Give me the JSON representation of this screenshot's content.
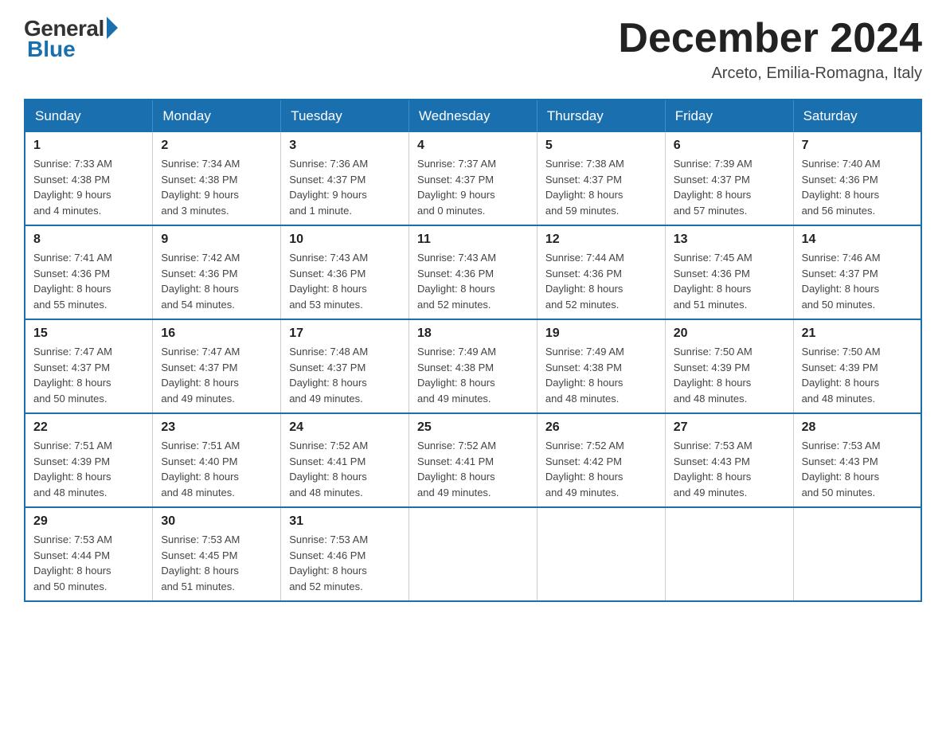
{
  "header": {
    "logo_general": "General",
    "logo_blue": "Blue",
    "month_title": "December 2024",
    "location": "Arceto, Emilia-Romagna, Italy"
  },
  "days_of_week": [
    "Sunday",
    "Monday",
    "Tuesday",
    "Wednesday",
    "Thursday",
    "Friday",
    "Saturday"
  ],
  "weeks": [
    [
      {
        "day": "1",
        "sunrise": "7:33 AM",
        "sunset": "4:38 PM",
        "daylight": "9 hours and 4 minutes."
      },
      {
        "day": "2",
        "sunrise": "7:34 AM",
        "sunset": "4:38 PM",
        "daylight": "9 hours and 3 minutes."
      },
      {
        "day": "3",
        "sunrise": "7:36 AM",
        "sunset": "4:37 PM",
        "daylight": "9 hours and 1 minute."
      },
      {
        "day": "4",
        "sunrise": "7:37 AM",
        "sunset": "4:37 PM",
        "daylight": "9 hours and 0 minutes."
      },
      {
        "day": "5",
        "sunrise": "7:38 AM",
        "sunset": "4:37 PM",
        "daylight": "8 hours and 59 minutes."
      },
      {
        "day": "6",
        "sunrise": "7:39 AM",
        "sunset": "4:37 PM",
        "daylight": "8 hours and 57 minutes."
      },
      {
        "day": "7",
        "sunrise": "7:40 AM",
        "sunset": "4:36 PM",
        "daylight": "8 hours and 56 minutes."
      }
    ],
    [
      {
        "day": "8",
        "sunrise": "7:41 AM",
        "sunset": "4:36 PM",
        "daylight": "8 hours and 55 minutes."
      },
      {
        "day": "9",
        "sunrise": "7:42 AM",
        "sunset": "4:36 PM",
        "daylight": "8 hours and 54 minutes."
      },
      {
        "day": "10",
        "sunrise": "7:43 AM",
        "sunset": "4:36 PM",
        "daylight": "8 hours and 53 minutes."
      },
      {
        "day": "11",
        "sunrise": "7:43 AM",
        "sunset": "4:36 PM",
        "daylight": "8 hours and 52 minutes."
      },
      {
        "day": "12",
        "sunrise": "7:44 AM",
        "sunset": "4:36 PM",
        "daylight": "8 hours and 52 minutes."
      },
      {
        "day": "13",
        "sunrise": "7:45 AM",
        "sunset": "4:36 PM",
        "daylight": "8 hours and 51 minutes."
      },
      {
        "day": "14",
        "sunrise": "7:46 AM",
        "sunset": "4:37 PM",
        "daylight": "8 hours and 50 minutes."
      }
    ],
    [
      {
        "day": "15",
        "sunrise": "7:47 AM",
        "sunset": "4:37 PM",
        "daylight": "8 hours and 50 minutes."
      },
      {
        "day": "16",
        "sunrise": "7:47 AM",
        "sunset": "4:37 PM",
        "daylight": "8 hours and 49 minutes."
      },
      {
        "day": "17",
        "sunrise": "7:48 AM",
        "sunset": "4:37 PM",
        "daylight": "8 hours and 49 minutes."
      },
      {
        "day": "18",
        "sunrise": "7:49 AM",
        "sunset": "4:38 PM",
        "daylight": "8 hours and 49 minutes."
      },
      {
        "day": "19",
        "sunrise": "7:49 AM",
        "sunset": "4:38 PM",
        "daylight": "8 hours and 48 minutes."
      },
      {
        "day": "20",
        "sunrise": "7:50 AM",
        "sunset": "4:39 PM",
        "daylight": "8 hours and 48 minutes."
      },
      {
        "day": "21",
        "sunrise": "7:50 AM",
        "sunset": "4:39 PM",
        "daylight": "8 hours and 48 minutes."
      }
    ],
    [
      {
        "day": "22",
        "sunrise": "7:51 AM",
        "sunset": "4:39 PM",
        "daylight": "8 hours and 48 minutes."
      },
      {
        "day": "23",
        "sunrise": "7:51 AM",
        "sunset": "4:40 PM",
        "daylight": "8 hours and 48 minutes."
      },
      {
        "day": "24",
        "sunrise": "7:52 AM",
        "sunset": "4:41 PM",
        "daylight": "8 hours and 48 minutes."
      },
      {
        "day": "25",
        "sunrise": "7:52 AM",
        "sunset": "4:41 PM",
        "daylight": "8 hours and 49 minutes."
      },
      {
        "day": "26",
        "sunrise": "7:52 AM",
        "sunset": "4:42 PM",
        "daylight": "8 hours and 49 minutes."
      },
      {
        "day": "27",
        "sunrise": "7:53 AM",
        "sunset": "4:43 PM",
        "daylight": "8 hours and 49 minutes."
      },
      {
        "day": "28",
        "sunrise": "7:53 AM",
        "sunset": "4:43 PM",
        "daylight": "8 hours and 50 minutes."
      }
    ],
    [
      {
        "day": "29",
        "sunrise": "7:53 AM",
        "sunset": "4:44 PM",
        "daylight": "8 hours and 50 minutes."
      },
      {
        "day": "30",
        "sunrise": "7:53 AM",
        "sunset": "4:45 PM",
        "daylight": "8 hours and 51 minutes."
      },
      {
        "day": "31",
        "sunrise": "7:53 AM",
        "sunset": "4:46 PM",
        "daylight": "8 hours and 52 minutes."
      },
      null,
      null,
      null,
      null
    ]
  ]
}
